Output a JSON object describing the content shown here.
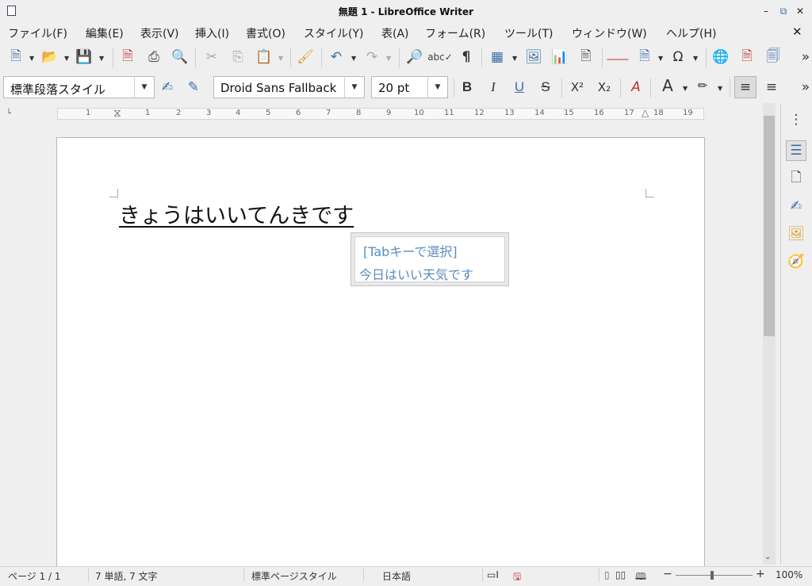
{
  "window": {
    "title": "無題 1 - LibreOffice Writer",
    "minimize_icon": "minimize-icon",
    "restore_icon": "restore-icon",
    "close_icon": "close-icon"
  },
  "menu": {
    "items": [
      "ファイル(F)",
      "編集(E)",
      "表示(V)",
      "挿入(I)",
      "書式(O)",
      "スタイル(Y)",
      "表(A)",
      "フォーム(R)",
      "ツール(T)",
      "ウィンドウ(W)",
      "ヘルプ(H)"
    ],
    "close_document_icon": "close-icon"
  },
  "formatting": {
    "paragraph_style": "標準段落スタイル",
    "font_name": "Droid Sans Fallback",
    "font_size": "20 pt",
    "bold_label": "B",
    "italic_label": "I",
    "underline_label": "U",
    "strike_label": "S",
    "superscript_label": "X²",
    "subscript_label": "X₂"
  },
  "ruler": {
    "numbers": [
      "1",
      "1",
      "2",
      "3",
      "4",
      "5",
      "6",
      "7",
      "8",
      "9",
      "10",
      "11",
      "12",
      "13",
      "14",
      "15",
      "16",
      "17",
      "18",
      "19"
    ]
  },
  "document": {
    "text": "きょうはいいてんきです",
    "autocomplete_hint": "[Tabキーで選択]",
    "autocomplete_suggestion": "今日はいい天気です"
  },
  "status": {
    "page": "ページ 1 / 1",
    "word_count": "7 単語, 7 文字",
    "page_style": "標準ページスタイル",
    "language": "日本語",
    "zoom": "100%"
  },
  "colors": {
    "icon_blue": "#3a6fa8",
    "autocomplete_text": "#5a8cc0",
    "font_color_red": "#c81e1e",
    "highlight_yellow": "#f2e800"
  }
}
